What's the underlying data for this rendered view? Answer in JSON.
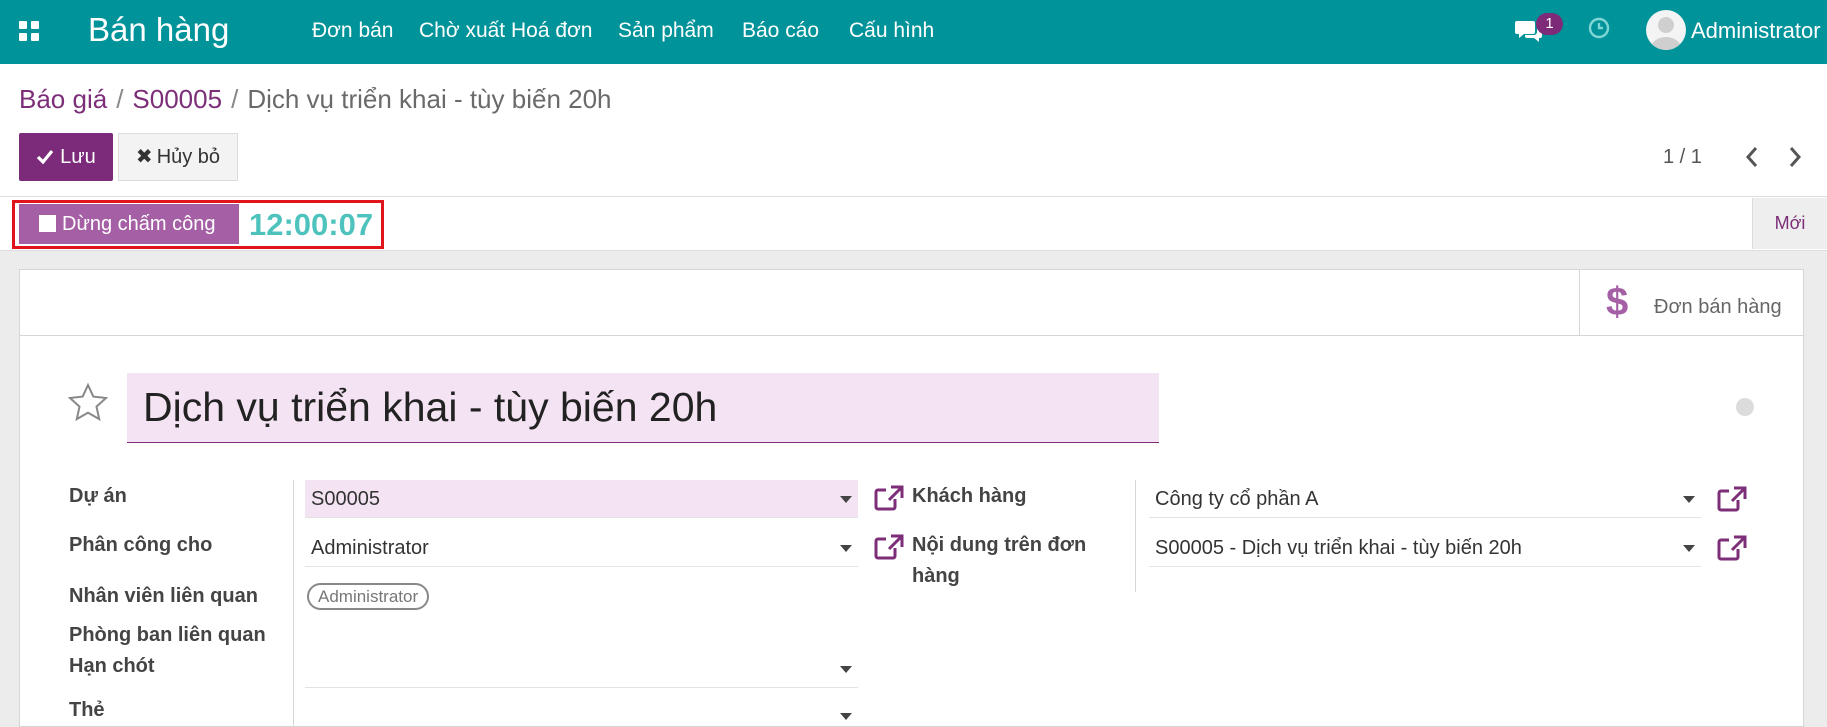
{
  "navbar": {
    "app_title": "Bán hàng",
    "menu": [
      "Đơn bán",
      "Chờ xuất Hoá đơn",
      "Sản phẩm",
      "Báo cáo",
      "Cấu hình"
    ],
    "message_count": "1",
    "user_name": "Administrator"
  },
  "breadcrumb": {
    "items": [
      "Báo giá",
      "S00005"
    ],
    "current": "Dịch vụ triển khai - tùy biến 20h"
  },
  "toolbar": {
    "save_label": "Lưu",
    "discard_label": "Hủy bỏ",
    "pager": "1 / 1"
  },
  "statusbar": {
    "stop_label": "Dừng chấm công",
    "timer": "12:00:07",
    "new_label": "Mới"
  },
  "smart_button": {
    "label": "Đơn bán hàng"
  },
  "form": {
    "title": "Dịch vụ triển khai - tùy biến 20h",
    "left_labels": {
      "project": "Dự án",
      "assigned": "Phân công cho",
      "employees": "Nhân viên liên quan",
      "department": "Phòng ban liên quan",
      "deadline": "Hạn chót",
      "tags": "Thẻ"
    },
    "project_value": "S00005",
    "assigned_value": "Administrator",
    "employee_tag": "Administrator",
    "right_labels": {
      "customer": "Khách hàng",
      "order_line": "Nội dung trên đơn hàng"
    },
    "order_line_label_lines": [
      "Nội dung trên đơn",
      "hàng"
    ],
    "customer_value": "Công ty cổ phần A",
    "order_line_value": "S00005 -  Dịch vụ triển khai - tùy biến 20h"
  },
  "colors": {
    "navbar": "#00939a",
    "primary": "#7c2a7a",
    "timer": "#4ec3bd",
    "highlight_box": "#e0141b",
    "field_highlight": "#f4e4f3"
  },
  "icons": [
    "apps-icon",
    "chat-icon",
    "clock-icon",
    "avatar",
    "check-icon",
    "close-icon",
    "chevron-left-icon",
    "chevron-right-icon",
    "stop-icon",
    "dollar-icon",
    "star-icon",
    "external-link-icon",
    "caret-down-icon"
  ]
}
